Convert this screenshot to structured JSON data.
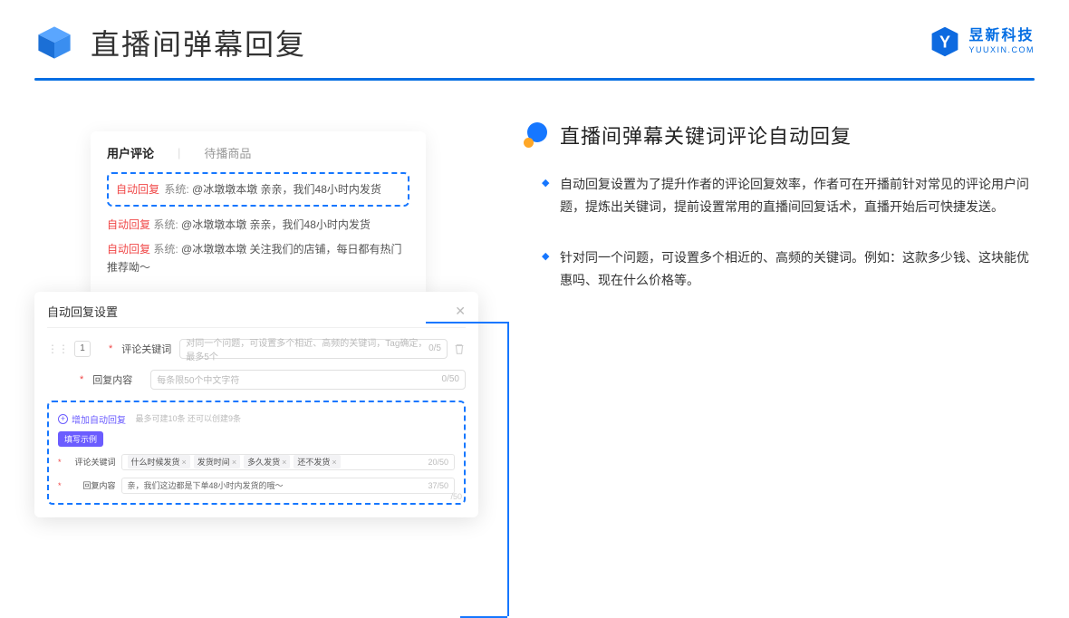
{
  "title": "直播间弹幕回复",
  "logo": {
    "cn": "昱新科技",
    "en": "YUUXIN.COM"
  },
  "card1": {
    "tab1": "用户评论",
    "sep": "|",
    "tab2": "待播商品",
    "msg1_tag": "自动回复",
    "msg1_sys": " 系统: ",
    "msg1_body": "@冰墩墩本墩 亲亲，我们48小时内发货",
    "msg2_tag": "自动回复",
    "msg2_sys": " 系统: ",
    "msg2_body": "@冰墩墩本墩 亲亲，我们48小时内发货",
    "msg3_tag": "自动回复",
    "msg3_sys": " 系统: ",
    "msg3_body": "@冰墩墩本墩 关注我们的店铺，每日都有热门推荐呦～"
  },
  "card2": {
    "title": "自动回复设置",
    "num": "1",
    "kw_label": "评论关键词",
    "kw_ph": "对同一个问题，可设置多个相近、高频的关键词，Tag确定，最多5个",
    "kw_cnt": "0/5",
    "rc_label": "回复内容",
    "rc_ph": "每条限50个中文字符",
    "rc_cnt": "0/50",
    "add": "增加自动回复",
    "add_hint": "最多可建10条 还可以创建9条",
    "badge": "填写示例",
    "ex_kw_lbl": "评论关键词",
    "ex_kw_tags": [
      "什么时候发货",
      "发货时间",
      "多久发货",
      "还不发货"
    ],
    "ex_kw_cnt": "20/50",
    "ex_rc_lbl": "回复内容",
    "ex_rc_text": "亲，我们这边都是下单48小时内发货的哦～",
    "ex_rc_cnt": "37/50",
    "outer_cnt": "/50"
  },
  "right": {
    "title": "直播间弹幕关键词评论自动回复",
    "b1": "自动回复设置为了提升作者的评论回复效率，作者可在开播前针对常见的评论用户问题，提炼出关键词，提前设置常用的直播间回复话术，直播开始后可快捷发送。",
    "b2": "针对同一个问题，可设置多个相近的、高频的关键词。例如：这款多少钱、这块能优惠吗、现在什么价格等。"
  }
}
